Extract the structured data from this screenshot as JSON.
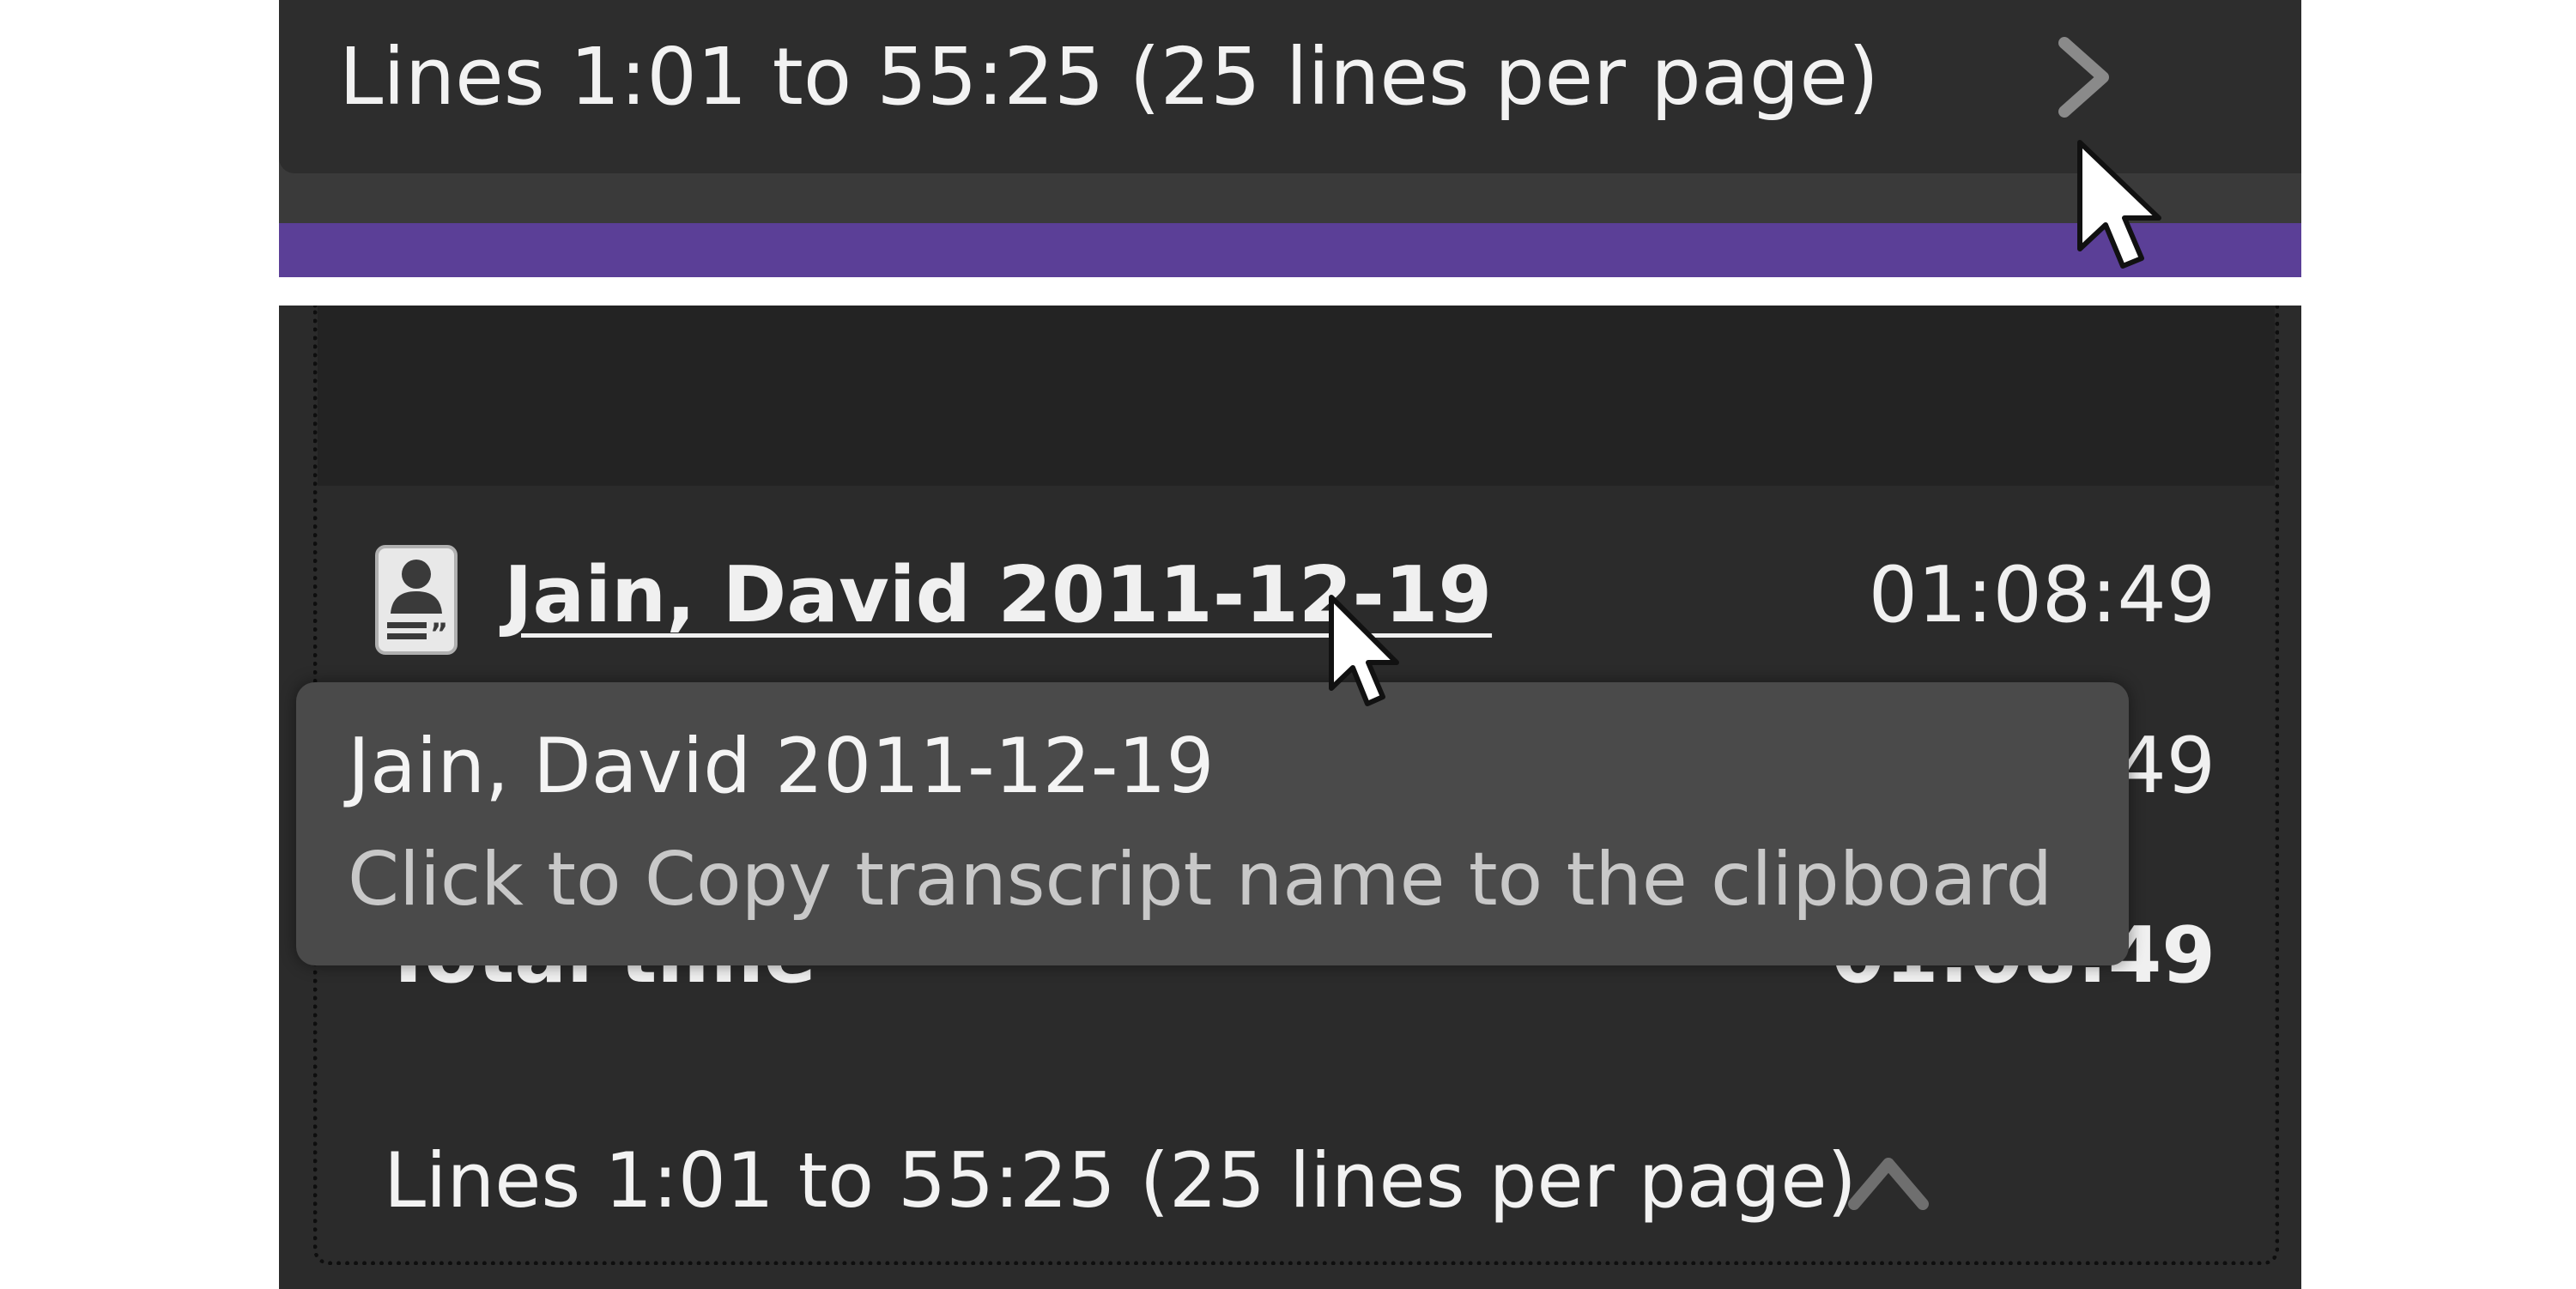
{
  "colors": {
    "accent": "#5b3f97",
    "panel_dark": "#2b2b2b",
    "tooltip_bg": "#4a4a4a",
    "text": "#f0f0f0",
    "muted_text": "#c8c8c8"
  },
  "top": {
    "pagination_label": "Lines 1:01 to 55:25 (25 lines per page)",
    "next_icon": "chevron-right-icon"
  },
  "summary": {
    "transcript": {
      "icon": "transcript-icon",
      "name": "Jain, David 2011-12-19",
      "duration": "01:08:49"
    },
    "row2_duration_partial": "49",
    "total": {
      "label": "Total time",
      "value": "01:08:49"
    },
    "pagination_label": "Lines 1:01 to 55:25 (25 lines per page)",
    "collapse_icon": "chevron-up-icon"
  },
  "tooltip": {
    "title": "Jain, David 2011-12-19",
    "hint": "Click to Copy transcript name to the clipboard"
  }
}
